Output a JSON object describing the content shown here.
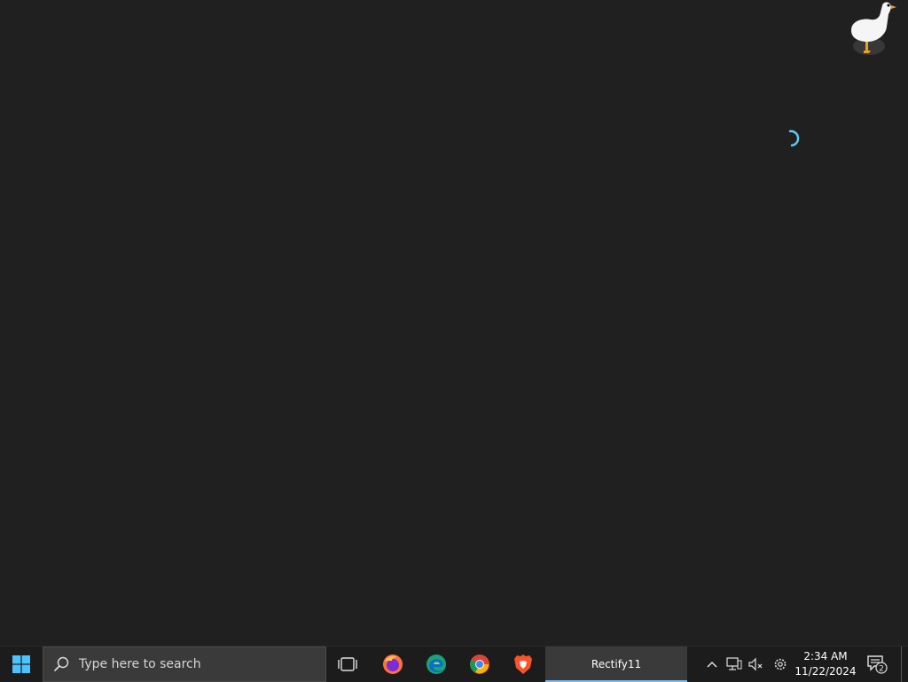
{
  "taskbar": {
    "search": {
      "placeholder": "Type here to search"
    },
    "pinned_apps": [
      {
        "name": "Firefox",
        "icon": "firefox-icon"
      },
      {
        "name": "Microsoft Edge",
        "icon": "edge-icon"
      },
      {
        "name": "Google Chrome",
        "icon": "chrome-icon"
      },
      {
        "name": "Brave",
        "icon": "brave-icon"
      }
    ],
    "active_app": {
      "label": "Rectify11"
    },
    "tray": {
      "time": "2:34 AM",
      "date": "11/22/2024",
      "notification_count": "2"
    }
  },
  "colors": {
    "desktop_bg": "#202020",
    "taskbar_bg": "#1c1c1c",
    "accent": "#76b9ed"
  }
}
